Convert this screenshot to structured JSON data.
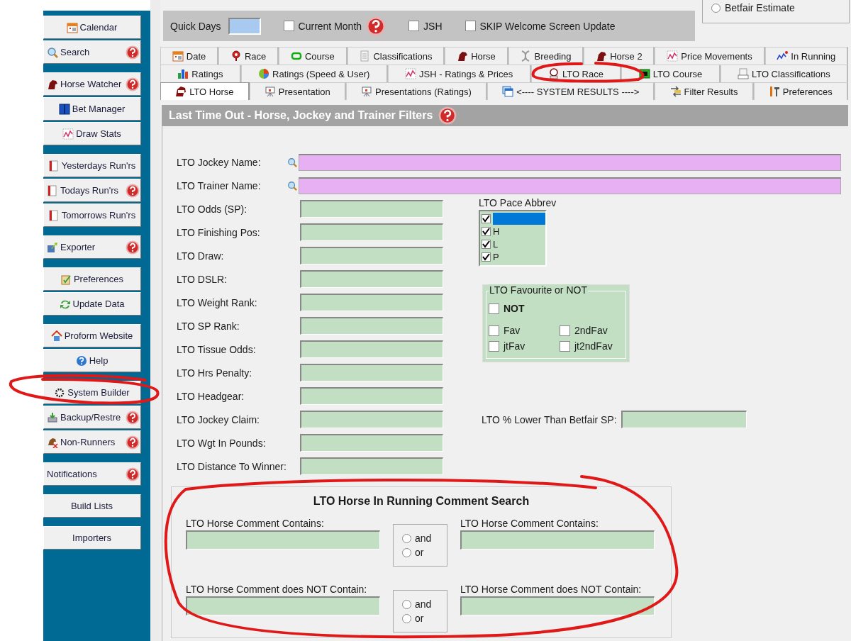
{
  "sidebar": {
    "groups": [
      {
        "items": [
          {
            "label": "Calendar",
            "help": false
          },
          {
            "label": "Search",
            "help": true
          }
        ]
      },
      {
        "items": [
          {
            "label": "Horse Watcher",
            "help": true
          },
          {
            "label": "Bet Manager",
            "help": false
          },
          {
            "label": "Draw Stats",
            "help": false
          }
        ]
      },
      {
        "items": [
          {
            "label": "Yesterdays Run'rs",
            "help": false
          },
          {
            "label": "Todays Run'rs",
            "help": true
          },
          {
            "label": "Tomorrows Run'rs",
            "help": false
          }
        ]
      },
      {
        "items": [
          {
            "label": "Exporter",
            "help": true
          }
        ]
      },
      {
        "items": [
          {
            "label": "Preferences",
            "help": false
          },
          {
            "label": "Update Data",
            "help": false
          }
        ]
      },
      {
        "items": [
          {
            "label": "Proform Website",
            "help": false
          },
          {
            "label": "Help",
            "help": false
          }
        ]
      },
      {
        "items": [
          {
            "label": "System Builder",
            "help": false
          },
          {
            "label": "Backup/Restre",
            "help": true
          },
          {
            "label": "Non-Runners",
            "help": true
          }
        ]
      },
      {
        "items": [
          {
            "label": "Notifications",
            "help": true
          }
        ]
      },
      {
        "items": [
          {
            "label": "Build Lists",
            "help": false
          }
        ]
      },
      {
        "items": [
          {
            "label": "Importers",
            "help": false
          }
        ]
      }
    ]
  },
  "toolbar": {
    "quick_days_label": "Quick Days",
    "checkboxes": [
      {
        "label": "Current Month",
        "checked": false,
        "help": true
      },
      {
        "label": "JSH",
        "checked": false,
        "help": false
      },
      {
        "label": "SKIP Welcome Screen Update",
        "checked": false,
        "help": false
      }
    ],
    "estimate_option": {
      "label": "Betfair Estimate",
      "selected": false
    }
  },
  "tab_rows": [
    {
      "tabs": [
        {
          "label": "Date",
          "selected": false
        },
        {
          "label": "Race",
          "selected": false
        },
        {
          "label": "Course",
          "selected": false
        },
        {
          "label": "Classifications",
          "selected": false
        },
        {
          "label": "Horse",
          "selected": false
        },
        {
          "label": "Breeding",
          "selected": false
        },
        {
          "label": "Horse 2",
          "selected": false
        },
        {
          "label": "Price Movements",
          "selected": false
        },
        {
          "label": "In Running",
          "selected": false
        }
      ]
    },
    {
      "tabs": [
        {
          "label": "Ratings",
          "selected": false
        },
        {
          "label": "Ratings (Speed & User)",
          "selected": false
        },
        {
          "label": "JSH - Ratings & Prices",
          "selected": false
        },
        {
          "label": "LTO Race",
          "selected": false
        },
        {
          "label": "LTO Course",
          "selected": false
        },
        {
          "label": "LTO Classifications",
          "selected": false
        }
      ]
    },
    {
      "tabs": [
        {
          "label": "LTO Horse",
          "selected": true
        },
        {
          "label": "Presentation",
          "selected": false
        },
        {
          "label": "Presentations (Ratings)",
          "selected": false
        },
        {
          "label": "<---- SYSTEM RESULTS ---->",
          "selected": false
        },
        {
          "label": "Filter Results",
          "selected": false
        },
        {
          "label": "Preferences",
          "selected": false
        }
      ]
    }
  ],
  "panel": {
    "title": "Last Time Out - Horse, Jockey and Trainer Filters",
    "help": true,
    "search_fields": [
      {
        "label": "LTO Jockey Name:"
      },
      {
        "label": "LTO Trainer Name:"
      }
    ],
    "fields": [
      {
        "label": "LTO Odds (SP):"
      },
      {
        "label": "LTO Finishing Pos:"
      },
      {
        "label": "LTO Draw:"
      },
      {
        "label": "LTO DSLR:"
      },
      {
        "label": "LTO Weight Rank:"
      },
      {
        "label": "LTO SP Rank:"
      },
      {
        "label": "LTO Tissue Odds:"
      },
      {
        "label": "LTO Hrs Penalty:"
      },
      {
        "label": "LTO Headgear:"
      },
      {
        "label": "LTO Jockey Claim:"
      },
      {
        "label": "LTO Wgt In Pounds:"
      },
      {
        "label": "LTO Distance To Winner:"
      }
    ],
    "pace": {
      "label": "LTO Pace Abbrev",
      "options": [
        {
          "checked": true,
          "selected": true
        },
        {
          "label": "H",
          "checked": true,
          "selected": false
        },
        {
          "label": "L",
          "checked": true,
          "selected": false
        },
        {
          "label": "P",
          "checked": true,
          "selected": false
        }
      ]
    },
    "favourite": {
      "title": "LTO Favourite or NOT",
      "not_option": {
        "label": "NOT",
        "checked": false
      },
      "options": [
        {
          "label": "Fav",
          "checked": false
        },
        {
          "label": "2ndFav",
          "checked": false
        },
        {
          "label": "jtFav",
          "checked": false
        },
        {
          "label": "jt2ndFav",
          "checked": false
        }
      ]
    },
    "lower_than": {
      "label": "LTO % Lower Than Betfair SP:"
    },
    "comment_search": {
      "title": "LTO Horse In Running Comment Search",
      "rows": [
        {
          "left_label": "LTO Horse Comment Contains:",
          "right_label": "LTO Horse Comment Contains:",
          "options": [
            {
              "label": "and",
              "selected": false
            },
            {
              "label": "or",
              "selected": false
            }
          ]
        },
        {
          "left_label": "LTO Horse Comment does NOT Contain:",
          "right_label": "LTO Horse Comment does NOT Contain:",
          "options": [
            {
              "label": "and",
              "selected": false
            },
            {
              "label": "or",
              "selected": false
            }
          ]
        }
      ]
    }
  }
}
